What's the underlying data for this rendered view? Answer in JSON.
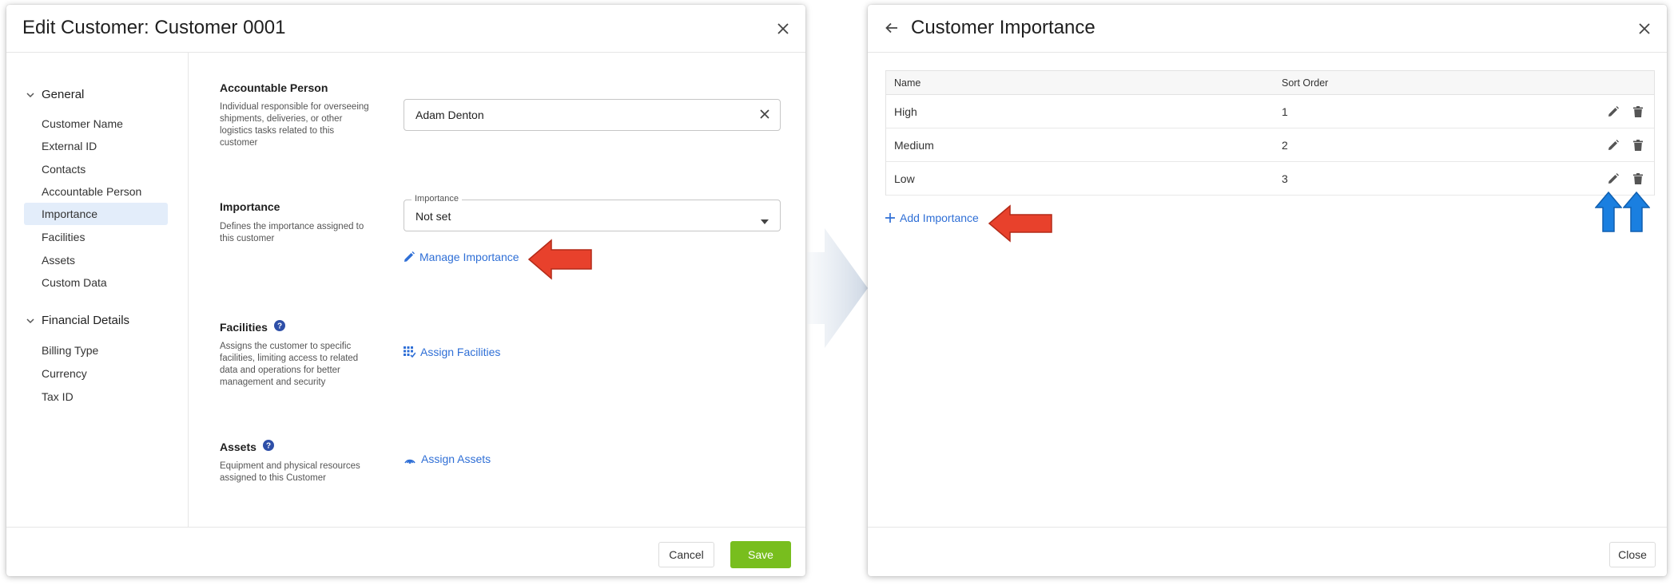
{
  "left_dialog": {
    "title": "Edit Customer: Customer 0001",
    "sidebar": {
      "groups": [
        {
          "label": "General"
        },
        {
          "label": "Financial Details"
        }
      ],
      "items": [
        {
          "label": "Customer Name"
        },
        {
          "label": "External ID"
        },
        {
          "label": "Contacts"
        },
        {
          "label": "Accountable Person"
        },
        {
          "label": "Importance"
        },
        {
          "label": "Facilities"
        },
        {
          "label": "Assets"
        },
        {
          "label": "Custom Data"
        },
        {
          "label": "Billing Type"
        },
        {
          "label": "Currency"
        },
        {
          "label": "Tax ID"
        }
      ]
    },
    "accountable": {
      "title": "Accountable Person",
      "desc": "Individual responsible for overseeing shipments, deliveries, or other logistics tasks related to this customer",
      "value": "Adam Denton"
    },
    "importance": {
      "title": "Importance",
      "desc": "Defines the importance assigned to this customer",
      "select_label": "Importance",
      "select_value": "Not set",
      "manage_link": "Manage Importance"
    },
    "facilities": {
      "title": "Facilities",
      "desc": "Assigns the customer to specific facilities, limiting access to related data and operations for better management and security",
      "assign_link": "Assign Facilities"
    },
    "assets": {
      "title": "Assets",
      "desc": "Equipment and physical resources assigned to this Customer",
      "assign_link": "Assign Assets"
    },
    "footer": {
      "cancel": "Cancel",
      "save": "Save"
    }
  },
  "right_dialog": {
    "title": "Customer Importance",
    "table": {
      "headers": {
        "name": "Name",
        "sort": "Sort Order"
      },
      "rows": [
        {
          "name": "High",
          "sort": "1"
        },
        {
          "name": "Medium",
          "sort": "2"
        },
        {
          "name": "Low",
          "sort": "3"
        }
      ]
    },
    "add_link": "Add Importance",
    "footer": {
      "close": "Close"
    }
  },
  "colors": {
    "accent_blue": "#2f6fd6",
    "save_green": "#78be1e",
    "annotation_red": "#e8412c",
    "annotation_blue": "#1a7fe0",
    "active_item_bg": "#e3edfa"
  }
}
